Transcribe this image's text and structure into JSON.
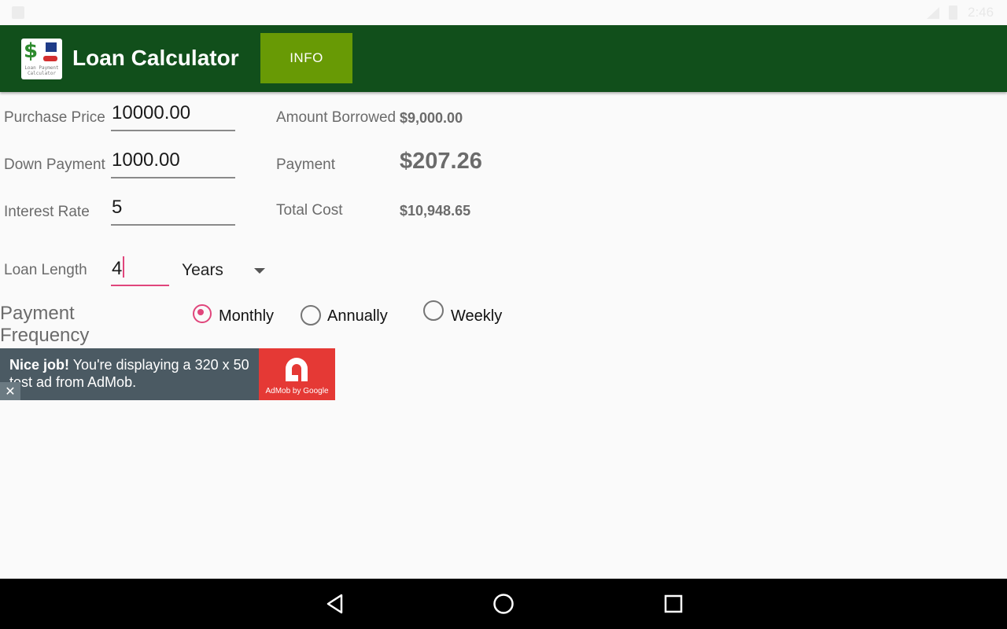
{
  "status": {
    "time": "2:46"
  },
  "app": {
    "title": "Loan Calculator",
    "info_label": "INFO",
    "logo_caption": "Loan Payment Calculator",
    "logo_symbol": "$"
  },
  "form": {
    "purchase_price": {
      "label": "Purchase Price",
      "value": "10000.00"
    },
    "down_payment": {
      "label": "Down Payment",
      "value": "1000.00"
    },
    "interest_rate": {
      "label": "Interest Rate",
      "value": "5"
    },
    "loan_length": {
      "label": "Loan Length",
      "value": "4",
      "unit": "Years"
    }
  },
  "results": {
    "amount_borrowed": {
      "label": "Amount Borrowed",
      "value": "$9,000.00"
    },
    "payment": {
      "label": "Payment",
      "value": "$207.26"
    },
    "total_cost": {
      "label": "Total Cost",
      "value": "$10,948.65"
    }
  },
  "frequency": {
    "label_line1": "Payment",
    "label_line2": "Frequency",
    "options": [
      {
        "label": "Monthly",
        "checked": true
      },
      {
        "label": "Annually",
        "checked": false
      },
      {
        "label": "Weekly",
        "checked": false
      }
    ]
  },
  "ad": {
    "headline": "Nice job!",
    "body": " You're displaying a 320 x 50 test ad from AdMob.",
    "brand": "AdMob by Google",
    "close": "✕"
  },
  "colors": {
    "appbar": "#114f1b",
    "info_button": "#689a05",
    "accent": "#e0457b",
    "ad_red": "#e53935"
  },
  "icons": [
    "sd-card-icon",
    "signal-icon",
    "battery-icon",
    "back-icon",
    "home-icon",
    "recents-icon"
  ]
}
